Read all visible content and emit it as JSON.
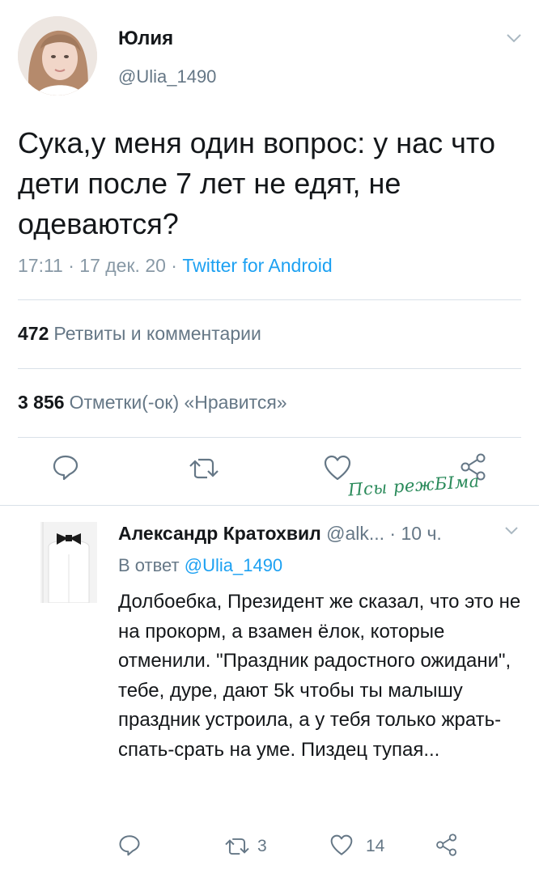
{
  "tweet": {
    "author_name": "Юлия",
    "author_handle": "@Ulia_1490",
    "text": "Сука,у меня один вопрос: у  нас что дети после 7 лет не едят, не одеваются?",
    "time": "17:11 · 17 дек. 20 · ",
    "source": "Twitter for Android",
    "retweets_count": "472",
    "retweets_label": "Ретвиты и комментарии",
    "likes_count": "3 856",
    "likes_label": "Отметки(-ок) «Нравится»"
  },
  "watermark": "Псы режБIма",
  "reply": {
    "author_name": "Александр Кратохвил",
    "author_handle": " @alk... · 10 ч.",
    "in_reply_label": "В ответ ",
    "in_reply_mention": "@Ulia_1490",
    "text": "Долбоебка, Президент же сказал, что это не на прокорм, а взамен ёлок, которые отменили. \"Праздник радостного ожидани\", тебе, дуре, дают 5k чтобы ты малышу праздник устроила, а у тебя только жрать-спать-срать на уме. Пиздец тупая...",
    "retweet_count": "3",
    "like_count": "14"
  },
  "colors": {
    "link": "#1da1f2",
    "secondary_text": "#657786",
    "divider": "#d9e1e8"
  },
  "icons": [
    "chevron-down-icon",
    "reply-icon",
    "retweet-icon",
    "heart-icon",
    "share-icon"
  ]
}
